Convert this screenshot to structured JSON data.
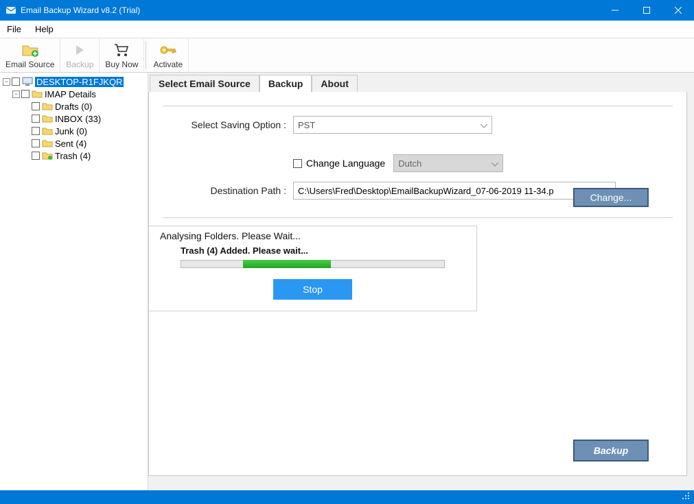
{
  "titlebar": {
    "app_name": "Email Backup Wizard v8.2 (Trial)"
  },
  "menubar": {
    "file": "File",
    "help": "Help"
  },
  "toolbar": {
    "email_source": "Email Source",
    "backup": "Backup",
    "buy_now": "Buy Now",
    "activate": "Activate"
  },
  "tree": {
    "root": "DESKTOP-R1FJKQR",
    "imap": "IMAP Details",
    "folders": [
      "Drafts (0)",
      "INBOX (33)",
      "Junk (0)",
      "Sent (4)",
      "Trash (4)"
    ]
  },
  "tabs": {
    "select_source": "Select Email Source",
    "backup": "Backup",
    "about": "About"
  },
  "form": {
    "saving_option_label": "Select Saving Option :",
    "saving_option_value": "PST",
    "change_language_label": "Change Language",
    "language_value": "Dutch",
    "destination_label": "Destination Path :",
    "destination_value": "C:\\Users\\Fred\\Desktop\\EmailBackupWizard_07-06-2019 11-34.p",
    "change_btn": "Change...",
    "backup_btn": "Backup"
  },
  "progress": {
    "title": "Analysing Folders. Please Wait...",
    "subtitle": "Trash (4) Added. Please wait...",
    "stop_btn": "Stop"
  }
}
